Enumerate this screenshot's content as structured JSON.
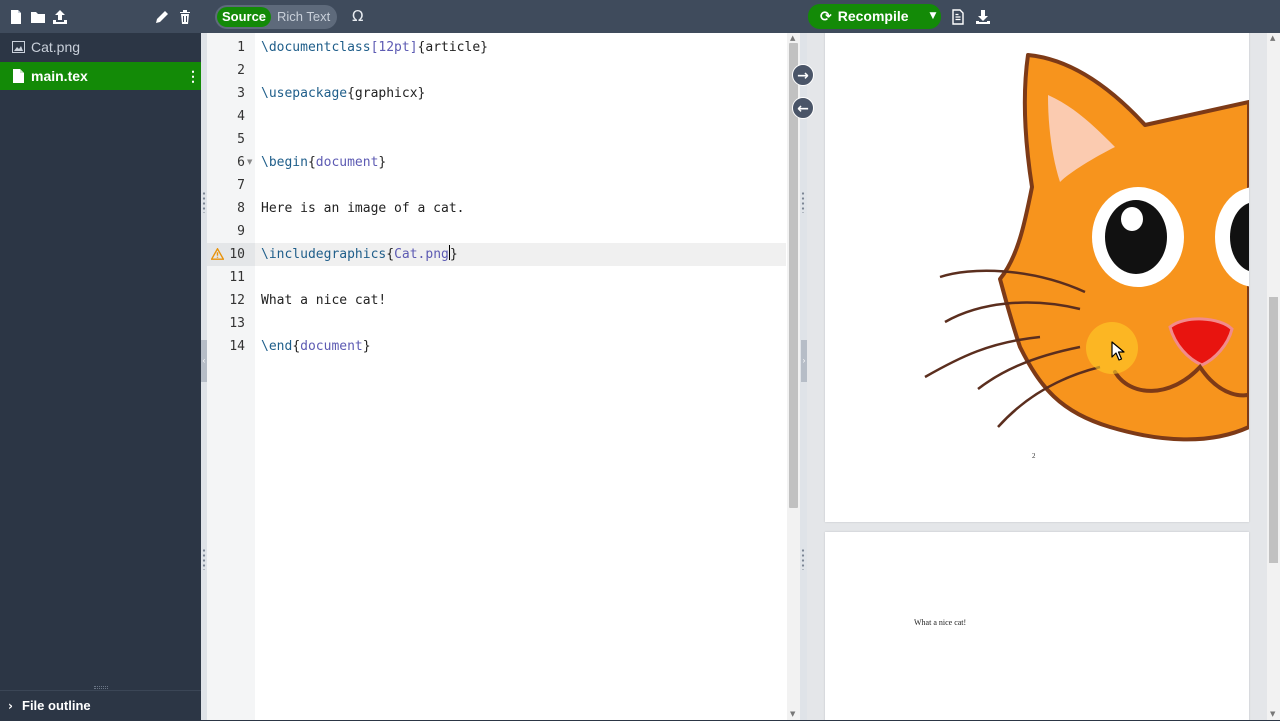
{
  "toolbar": {
    "mode_source": "Source",
    "mode_rich_text": "Rich Text",
    "symbol_palette": "Ω",
    "recompile_label": "Recompile",
    "icons": [
      "new-file-icon",
      "new-folder-icon",
      "upload-icon",
      "rename-icon",
      "delete-icon",
      "pdf-logs-icon",
      "download-pdf-icon"
    ]
  },
  "sidebar": {
    "files": [
      {
        "name": "Cat.png",
        "icon": "image-icon",
        "selected": false
      },
      {
        "name": "main.tex",
        "icon": "file-icon",
        "selected": true
      }
    ],
    "file_outline_label": "File outline"
  },
  "editor": {
    "line_numbers": [
      "1",
      "2",
      "3",
      "4",
      "5",
      "6",
      "7",
      "8",
      "9",
      "10",
      "11",
      "12",
      "13",
      "14"
    ],
    "active_line": "10",
    "warning_line": "10",
    "lines": {
      "l1": {
        "cmd": "\\documentclass",
        "opt": "[12pt]",
        "arg": "{article}"
      },
      "l3": {
        "cmd": "\\usepackage",
        "arg": "{graphicx}"
      },
      "l6": {
        "cmd": "\\begin",
        "arg_open": "{",
        "arg_name": "document",
        "arg_close": "}"
      },
      "l8": {
        "text": "Here is an image of a cat."
      },
      "l10": {
        "cmd": "\\includegraphics",
        "arg_open": "{",
        "arg_name": "Cat.png",
        "arg_close": "}"
      },
      "l12": {
        "text": "What a nice cat!"
      },
      "l14": {
        "cmd": "\\end",
        "arg_open": "{",
        "arg_name": "document",
        "arg_close": "}"
      }
    }
  },
  "preview": {
    "page_number": "2",
    "page2_text": "What a nice cat!"
  },
  "colors": {
    "accent_green": "#138a07",
    "toolbar_bg": "#3f4b5c",
    "sidebar_bg": "#2c3645",
    "cat_orange": "#f7941d",
    "nose_red": "#e8140f"
  }
}
